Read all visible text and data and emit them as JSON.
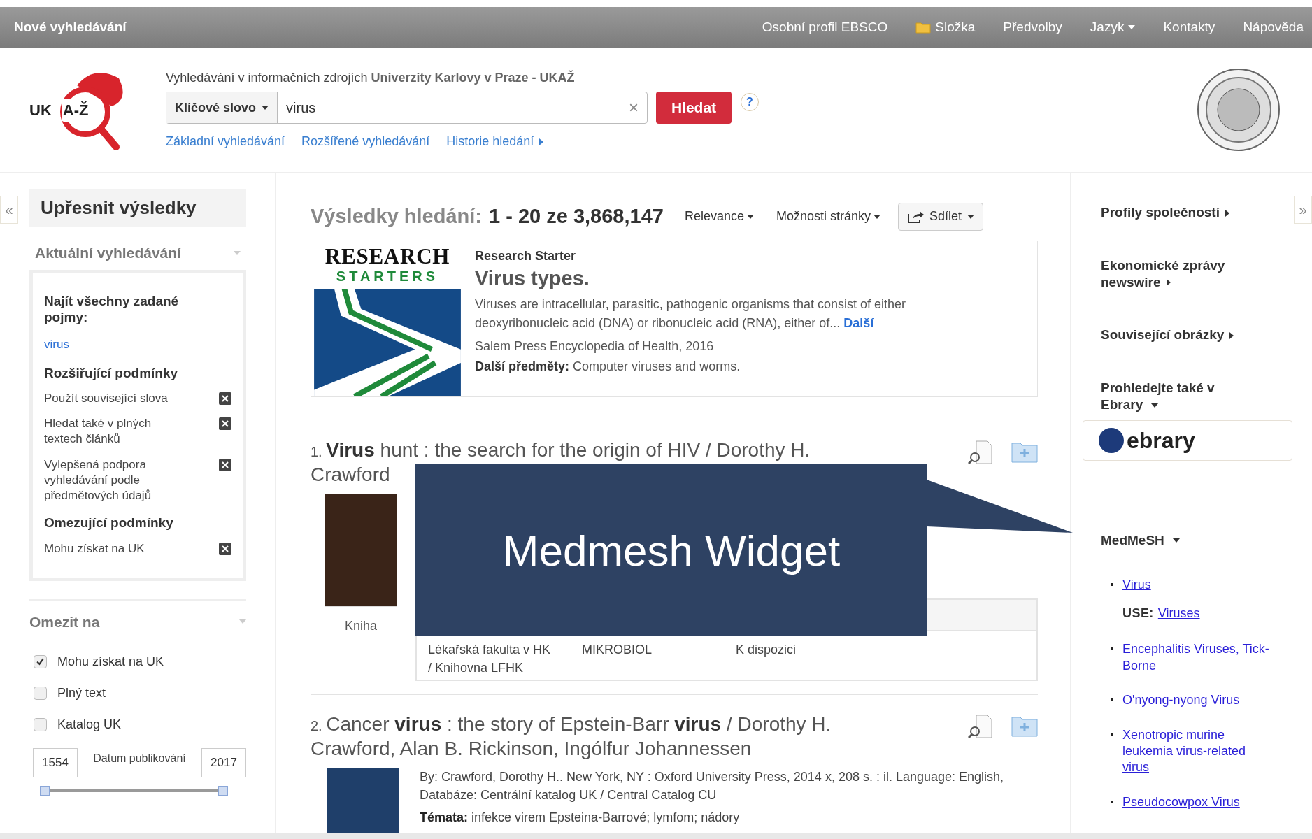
{
  "top_bar": {
    "title": "Nové vyhledávání",
    "links": [
      {
        "label": "Osobní profil EBSCO",
        "kind": "plain"
      },
      {
        "label": "Složka",
        "kind": "folder"
      },
      {
        "label": "Předvolby",
        "kind": "plain"
      },
      {
        "label": "Jazyk",
        "kind": "dropdown"
      },
      {
        "label": "Kontakty",
        "kind": "plain"
      },
      {
        "label": "Nápověda",
        "kind": "plain"
      }
    ]
  },
  "header": {
    "logo": {
      "prefix": "UK",
      "mark": "A-Ž"
    },
    "caption": "Vyhledávání v informačních zdrojích **Univerzity Karlovy v Praze - UKAŽ**",
    "search": {
      "field_type": "Klíčové slovo",
      "value": "virus",
      "clear": "×",
      "button": "Hledat",
      "help": "?"
    },
    "links": [
      {
        "label": "Základní vyhledávání",
        "kind": "plain"
      },
      {
        "label": "Rozšířené vyhledávání",
        "kind": "plain"
      },
      {
        "label": "Historie hledání",
        "kind": "arrow"
      }
    ]
  },
  "left_panel": {
    "collapse": "«",
    "title": "Upřesnit výsledky",
    "current_search": {
      "title": "Aktuální vyhledávání",
      "groups": [
        {
          "title": "Najít všechny zadané pojmy:",
          "items": [
            {
              "label": "virus",
              "kind": "term"
            }
          ]
        },
        {
          "title": "Rozšiřující podmínky",
          "items": [
            {
              "label": "Použít související slova",
              "kind": "removable"
            },
            {
              "label": "Hledat také v plných textech článků",
              "kind": "removable"
            },
            {
              "label": "Vylepšená podpora vyhledávání podle předmětových údajů",
              "kind": "removable"
            }
          ]
        },
        {
          "title": "Omezující podmínky",
          "items": [
            {
              "label": "Mohu získat na UK",
              "kind": "removable"
            }
          ]
        }
      ]
    },
    "limit": {
      "title": "Omezit na",
      "options": [
        {
          "label": "Mohu získat na UK",
          "checked": true
        },
        {
          "label": "Plný text",
          "checked": false
        },
        {
          "label": "Katalog UK",
          "checked": false
        }
      ],
      "date": {
        "from": "1554",
        "label": "Datum publikování",
        "to": "2017",
        "level": 1
      }
    }
  },
  "results": {
    "heading": "Výsledky hledání:",
    "range": "1 - 20 ze 3,868,147",
    "sort": "Relevance",
    "page_options": "Možnosti stránky",
    "share": "Sdílet",
    "starter": {
      "logo_top": "RESEARCH",
      "logo_bottom": "STARTERS",
      "label": "Research Starter",
      "title": "Virus types.",
      "abstract": "Viruses are intracellular, parasitic, pathogenic organisms that consist of either deoxyribonucleic acid (DNA) or ribonucleic acid (RNA), either of...",
      "more": "Další",
      "source": "Salem Press Encyclopedia of Health, 2016",
      "subjects_label": "Další předměty:",
      "subjects": "Computer viruses and worms."
    },
    "items": [
      {
        "number": "1.",
        "title": "**Virus** hunt : the search for the origin of HIV / Dorothy H. Crawford",
        "type": "Kniha",
        "holdings": [
          {
            "location": "Lékařská fakulta v HK / Knihovna LFHK",
            "call_number": "MIKROBIOL",
            "status": "K dispozici"
          }
        ]
      },
      {
        "number": "2.",
        "title": "Cancer **virus** : the story of Epstein-Barr **virus** / Dorothy H. Crawford, Alan B. Rickinson, Ingólfur Johannessen",
        "details": "By: Crawford, Dorothy H.. New York, NY : Oxford University Press, 2014 x, 208 s. : il. Language: English, Databáze: Centrální katalog UK / Central Catalog CU",
        "subjects_label": "Témata:",
        "subjects": "infekce virem Epsteina-Barrové; lymfom; nádory"
      }
    ]
  },
  "right_panel": {
    "collapse": "»",
    "sections": [
      {
        "label": "Profily společností",
        "kind": "arrow"
      },
      {
        "label": "Ekonomické zprávy newswire",
        "kind": "arrow"
      },
      {
        "label": "Související obrázky",
        "kind": "underlined"
      },
      {
        "label": "Prohledejte také v Ebrary",
        "kind": "dropdown"
      }
    ],
    "ebrary": "ebrary",
    "medmesh": {
      "title": "MedMeSH",
      "items": [
        {
          "label": "Virus",
          "use_label": "USE:",
          "use": "Viruses"
        },
        {
          "label": "Encephalitis Viruses, Tick-Borne"
        },
        {
          "label": "O'nyong-nyong Virus"
        },
        {
          "label": "Xenotropic murine leukemia virus-related virus"
        },
        {
          "label": "Pseudocowpox Virus"
        }
      ]
    }
  },
  "callout": {
    "label": "Medmesh Widget"
  }
}
